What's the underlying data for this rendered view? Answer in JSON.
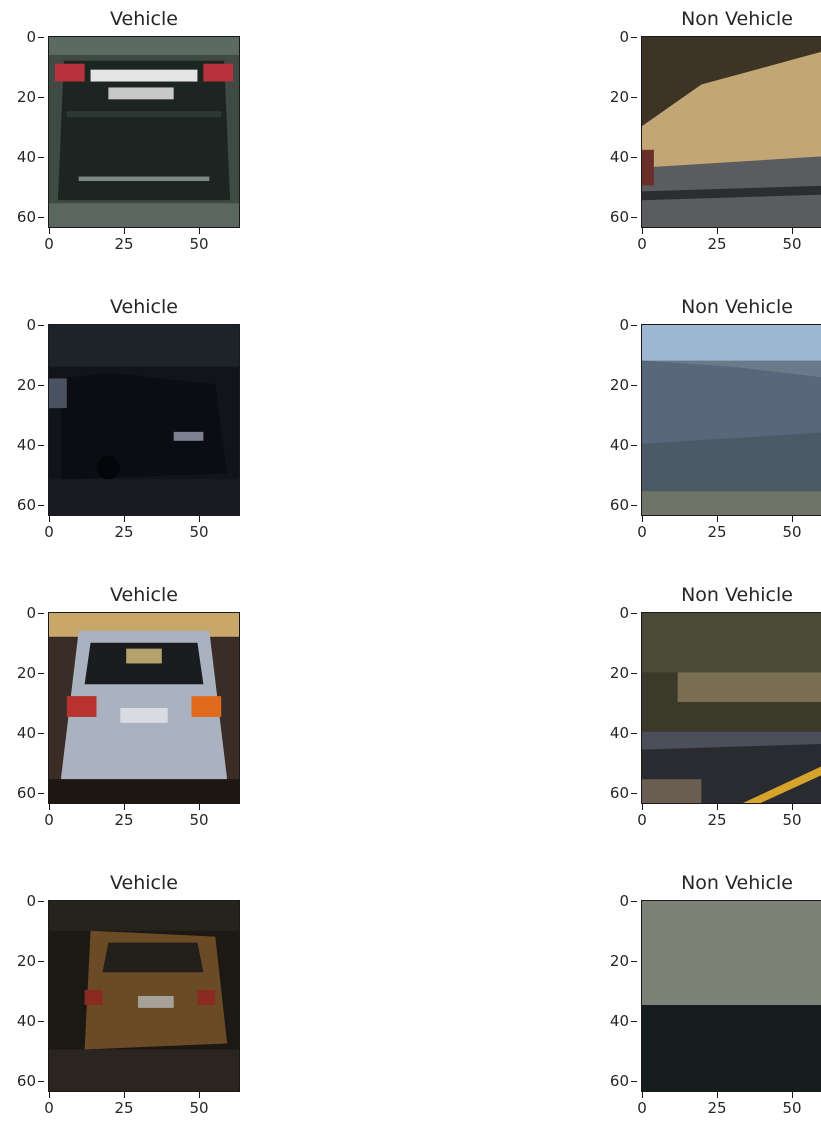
{
  "figure": {
    "panels": [
      {
        "title": "Vehicle",
        "scene": "car-dark-rear",
        "yticks": [
          "0",
          "20",
          "40",
          "60"
        ],
        "xticks": [
          "0",
          "25",
          "50"
        ]
      },
      {
        "title": "Non Vehicle",
        "scene": "dry-hillside-road",
        "yticks": [
          "0",
          "20",
          "40",
          "60"
        ],
        "xticks": [
          "0",
          "25",
          "50"
        ]
      },
      {
        "title": "Vehicle",
        "scene": "car-black-suv-night",
        "yticks": [
          "0",
          "20",
          "40",
          "60"
        ],
        "xticks": [
          "0",
          "25",
          "50"
        ]
      },
      {
        "title": "Non Vehicle",
        "scene": "hazy-mountain",
        "yticks": [
          "0",
          "20",
          "40",
          "60"
        ],
        "xticks": [
          "0",
          "25",
          "50"
        ]
      },
      {
        "title": "Vehicle",
        "scene": "car-silver-hatch",
        "yticks": [
          "0",
          "20",
          "40",
          "60"
        ],
        "xticks": [
          "0",
          "25",
          "50"
        ]
      },
      {
        "title": "Non Vehicle",
        "scene": "roadside-guardrail",
        "yticks": [
          "0",
          "20",
          "40",
          "60"
        ],
        "xticks": [
          "0",
          "25",
          "50"
        ]
      },
      {
        "title": "Vehicle",
        "scene": "car-brown-dim",
        "yticks": [
          "0",
          "20",
          "40",
          "60"
        ],
        "xticks": [
          "0",
          "25",
          "50"
        ]
      },
      {
        "title": "Non Vehicle",
        "scene": "two-tone-asphalt",
        "yticks": [
          "0",
          "20",
          "40",
          "60"
        ],
        "xticks": [
          "0",
          "25",
          "50"
        ]
      }
    ]
  }
}
